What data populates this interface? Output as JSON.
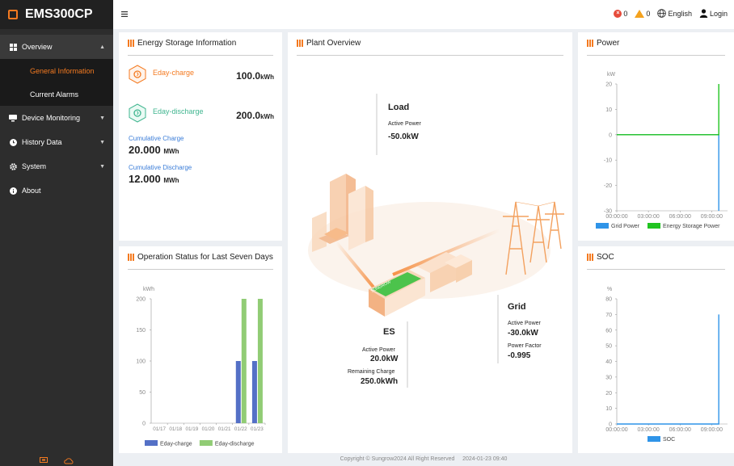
{
  "app": {
    "title": "EMS300CP"
  },
  "sidebar": {
    "overview": {
      "label": "Overview",
      "items": [
        "General Information",
        "Current Alarms"
      ]
    },
    "device_monitoring": "Device Monitoring",
    "history_data": "History Data",
    "system": "System",
    "about": "About"
  },
  "topbar": {
    "errors_count": "0",
    "warnings_count": "0",
    "language": "English",
    "login": "Login"
  },
  "energy_storage": {
    "title": "Energy Storage Information",
    "eday_charge_label": "Eday-charge",
    "eday_charge_value": "100.0",
    "eday_charge_unit": "kWh",
    "eday_discharge_label": "Eday-discharge",
    "eday_discharge_value": "200.0",
    "eday_discharge_unit": "kWh",
    "cumulative_charge_label": "Cumulative Charge",
    "cumulative_charge_value": "20.000",
    "cumulative_charge_unit": "MWh",
    "cumulative_discharge_label": "Cumulative Discharge",
    "cumulative_discharge_value": "12.000",
    "cumulative_discharge_unit": "MWh"
  },
  "plant": {
    "title": "Plant Overview",
    "load": {
      "heading": "Load",
      "active_power_label": "Active Power",
      "active_power_value": "-50.0kW"
    },
    "es": {
      "heading": "ES",
      "active_power_label": "Active Power",
      "active_power_value": "20.0kW",
      "remaining_label": "Remaining Charge",
      "remaining_value": "250.0kWh"
    },
    "grid": {
      "heading": "Grid",
      "active_power_label": "Active Power",
      "active_power_value": "-30.0kW",
      "power_factor_label": "Power Factor",
      "power_factor_value": "-0.995"
    },
    "container_label": "SUNGROW"
  },
  "colors": {
    "accent": "#f47a20",
    "grid_power": "#2f94e8",
    "storage_power": "#21c421",
    "eday_charge": "#5470c6",
    "eday_discharge": "#91cc75",
    "soc": "#2f94e8"
  },
  "footer": {
    "copyright": "Copyright © Sungrow2024 All Right Reserved",
    "datetime": "2024-01-23 09:40"
  },
  "chart_data": [
    {
      "id": "power",
      "title": "Power",
      "type": "line",
      "ylabel": "kW",
      "ylim": [
        -30,
        20
      ],
      "yticks": [
        20,
        10,
        0,
        -10,
        -20,
        -30
      ],
      "xticks": [
        "00:00:00",
        "03:00:00",
        "06:00:00",
        "09:00:00"
      ],
      "xrange_hours": [
        0,
        10.5
      ],
      "series": [
        {
          "name": "Grid Power",
          "color": "#2f94e8",
          "points": [
            [
              0,
              0
            ],
            [
              9.67,
              0
            ],
            [
              9.67,
              -30
            ]
          ]
        },
        {
          "name": "Energy Storage Power",
          "color": "#21c421",
          "points": [
            [
              0,
              0
            ],
            [
              9.67,
              0
            ],
            [
              9.67,
              20
            ]
          ]
        }
      ]
    },
    {
      "id": "seven_days",
      "title": "Operation Status for Last Seven Days",
      "type": "bar",
      "ylabel": "kWh",
      "ylim": [
        0,
        200
      ],
      "yticks": [
        0,
        50,
        100,
        150,
        200
      ],
      "categories": [
        "01/17",
        "01/18",
        "01/19",
        "01/20",
        "01/21",
        "01/22",
        "01/23"
      ],
      "series": [
        {
          "name": "Eday-charge",
          "color": "#5470c6",
          "values": [
            0,
            0,
            0,
            0,
            0,
            100,
            100
          ]
        },
        {
          "name": "Eday-discharge",
          "color": "#91cc75",
          "values": [
            0,
            0,
            0,
            0,
            0,
            200,
            200
          ]
        }
      ]
    },
    {
      "id": "soc",
      "title": "SOC",
      "type": "line",
      "ylabel": "%",
      "ylim": [
        0,
        80
      ],
      "yticks": [
        80,
        70,
        60,
        50,
        40,
        30,
        20,
        10,
        0
      ],
      "xticks": [
        "00:00:00",
        "03:00:00",
        "06:00:00",
        "09:00:00"
      ],
      "xrange_hours": [
        0,
        10.5
      ],
      "series": [
        {
          "name": "SOC",
          "color": "#2f94e8",
          "points": [
            [
              0,
              0
            ],
            [
              9.67,
              0
            ],
            [
              9.67,
              70
            ]
          ]
        }
      ]
    }
  ]
}
